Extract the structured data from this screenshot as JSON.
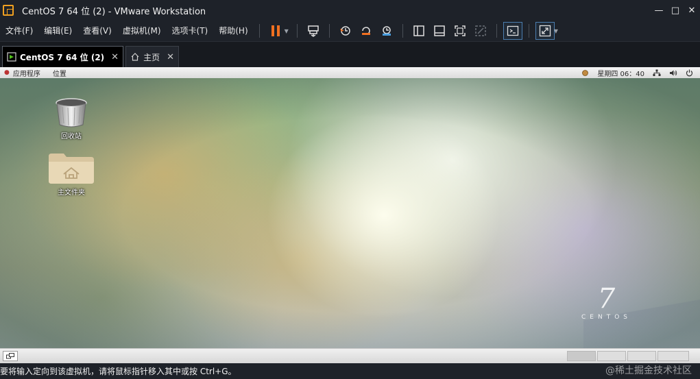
{
  "window": {
    "title": "CentOS 7 64 位 (2) - VMware Workstation",
    "controls": [
      "—",
      "□",
      "✕"
    ]
  },
  "menu": {
    "items": [
      "文件(F)",
      "编辑(E)",
      "查看(V)",
      "虚拟机(M)",
      "选项卡(T)",
      "帮助(H)"
    ]
  },
  "toolbar": {
    "accent": "#f07020",
    "icons": [
      "pause-icon",
      "send-ctrl-alt-del-icon",
      "snapshot-icon",
      "revert-snapshot-icon",
      "manage-snapshots-icon",
      "show-library-icon",
      "thumbnail-bar-icon",
      "full-screen-icon",
      "unity-icon",
      "console-view-icon",
      "stretch-view-icon"
    ]
  },
  "tabs": [
    {
      "label": "CentOS 7 64 位 (2)",
      "close": "✕",
      "active": true
    },
    {
      "label": "主页",
      "close": "✕",
      "active": false
    }
  ],
  "guest": {
    "top_panel": {
      "applications": "应用程序",
      "places": "位置",
      "clock": "星期四 06：40"
    },
    "desktop_icons": [
      {
        "label": "回收站"
      },
      {
        "label": "主文件夹"
      }
    ],
    "logo": {
      "seven": "7",
      "word": "CENTOS"
    }
  },
  "statusbar": {
    "text": "要将输入定向到该虚拟机，请将鼠标指针移入其中或按 Ctrl+G。",
    "watermark": "@稀土掘金技术社区"
  }
}
